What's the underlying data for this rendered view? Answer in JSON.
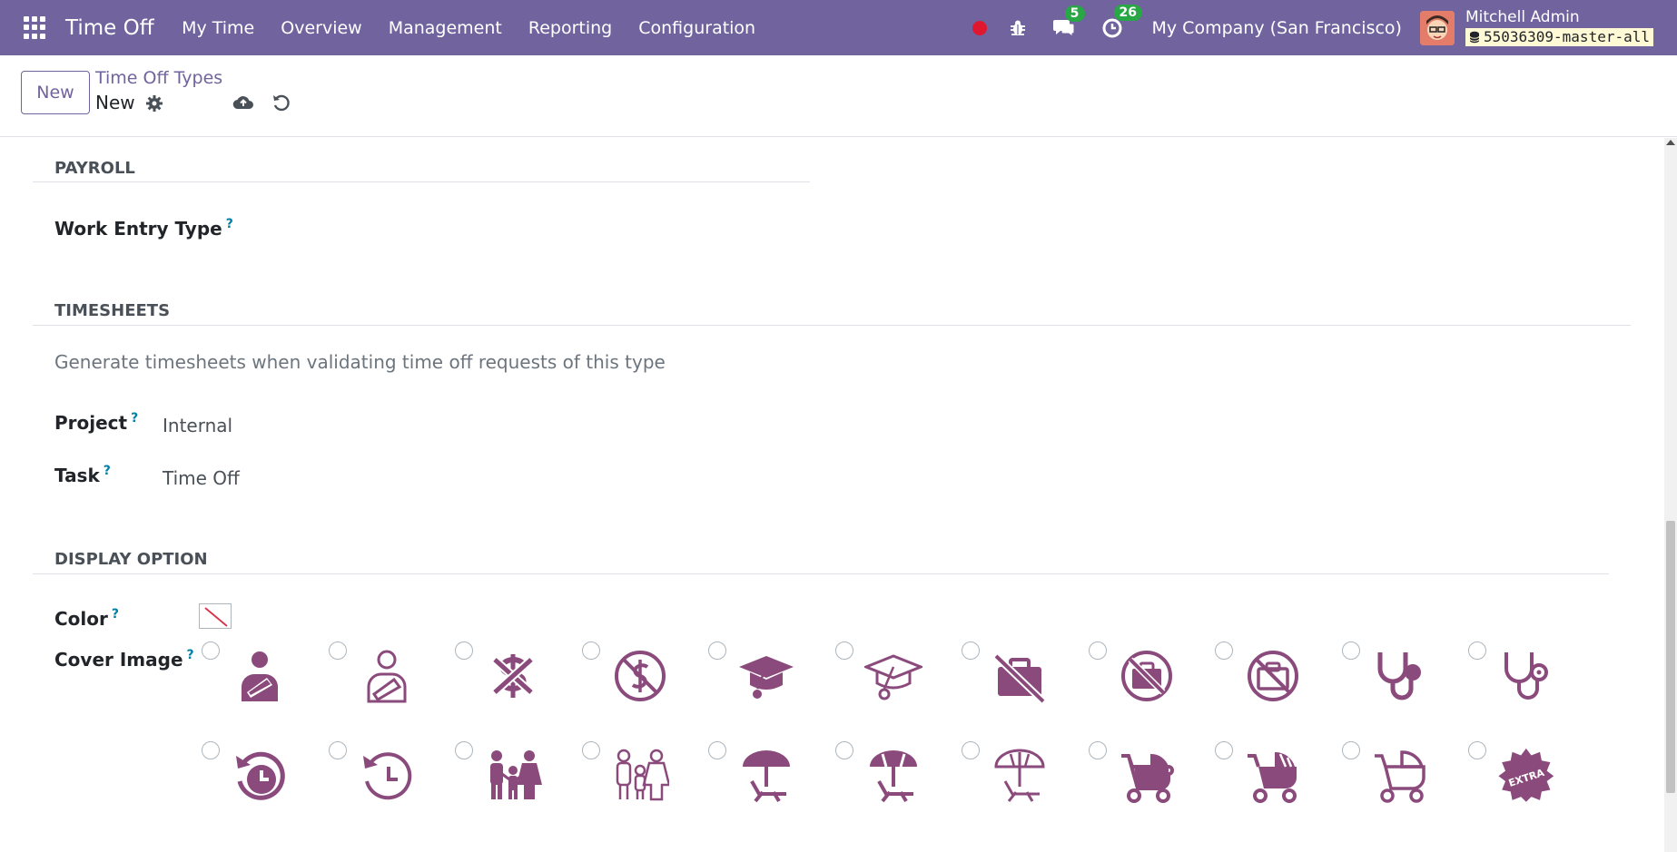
{
  "navbar": {
    "app_name": "Time Off",
    "menu": [
      "My Time",
      "Overview",
      "Management",
      "Reporting",
      "Configuration"
    ],
    "messages_count": "5",
    "activities_count": "26",
    "company": "My Company (San Francisco)",
    "user_name": "Mitchell Admin",
    "database": "55036309-master-all"
  },
  "control": {
    "new_label": "New",
    "breadcrumb": "Time Off Types",
    "record_name": "New"
  },
  "payroll": {
    "title": "PAYROLL",
    "work_entry_type_label": "Work Entry Type",
    "help": "?"
  },
  "timesheets": {
    "title": "TIMESHEETS",
    "description": "Generate timesheets when validating time off requests of this type",
    "project_label": "Project",
    "project_value": "Internal",
    "task_label": "Task",
    "task_value": "Time Off",
    "help": "?"
  },
  "display": {
    "title": "DISPLAY OPTION",
    "color_label": "Color",
    "cover_label": "Cover Image",
    "help": "?"
  },
  "cover_images": [
    [
      "injured-arm-filled",
      "injured-arm-outline",
      "no-money-filled",
      "no-money-circle",
      "graduation-cap-filled",
      "graduation-cap-outline",
      "no-briefcase-filled",
      "no-briefcase-circle-filled",
      "no-briefcase-circle-outline",
      "stethoscope-filled",
      "stethoscope-outline"
    ],
    [
      "history-filled",
      "history-outline",
      "family-filled",
      "family-outline",
      "beach-chair-filled",
      "beach-chair-striped",
      "beach-chair-outline",
      "stroller-filled",
      "stroller-striped",
      "stroller-outline",
      "extra-badge"
    ]
  ],
  "cover_badge_text": "EXTRA",
  "colors": {
    "brand": "#71639e",
    "icon": "#8b4a7c",
    "badge": "#28a745",
    "help": "#0180a5"
  }
}
